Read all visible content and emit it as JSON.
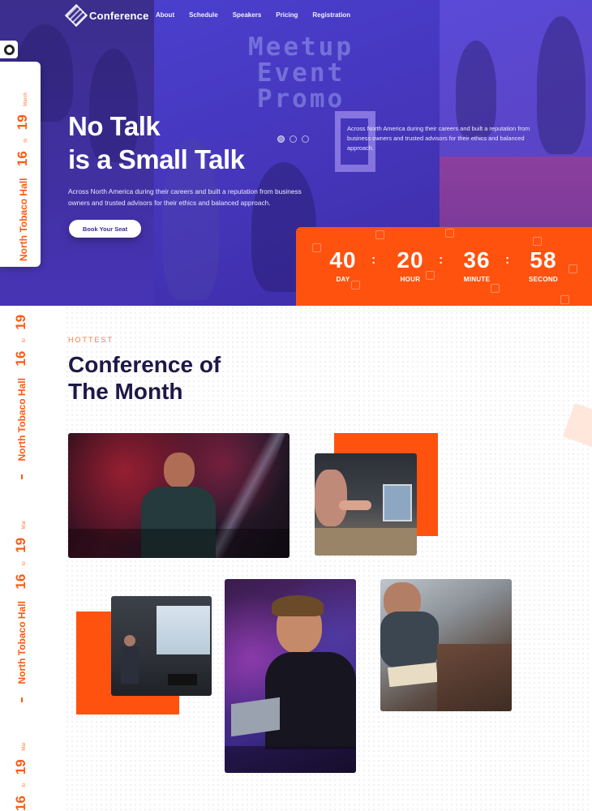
{
  "brand": {
    "name": "Conference"
  },
  "nav": {
    "items": [
      "About",
      "Schedule",
      "Speakers",
      "Pricing",
      "Registration"
    ]
  },
  "hero": {
    "watermark_lines": [
      "Meetup",
      "Event",
      "Promo"
    ],
    "title_line1": "No Talk",
    "title_line2": "is a Small Talk",
    "description": "Across North America during their careers and built a reputation from business owners and trusted advisors for their ethics and balanced approach.",
    "side_text": "Across North America during their careers and built a reputation from business owners and trusted advisors for their ethics and balanced approach.",
    "cta_label": "Book Your Seat",
    "slider_dots": 3
  },
  "countdown": {
    "items": [
      {
        "value": "40",
        "label": "DAY"
      },
      {
        "value": "20",
        "label": "HOUR"
      },
      {
        "value": "36",
        "label": "MINUTE"
      },
      {
        "value": "58",
        "label": "SECOND"
      }
    ],
    "separator": ":"
  },
  "side_badge": {
    "month": "March",
    "month_short": "Mar",
    "day_end": "19",
    "to": "to",
    "day_start": "16",
    "venue": "North Tobaco Hall"
  },
  "section": {
    "kicker": "HOTTEST",
    "title_line1": "Conference of",
    "title_line2": "The Month"
  },
  "colors": {
    "accent": "#ff520f",
    "hero_purple": "#4a36c4",
    "title_dark": "#1e1846"
  },
  "icons": [
    "support-icon",
    "logo-icon"
  ]
}
